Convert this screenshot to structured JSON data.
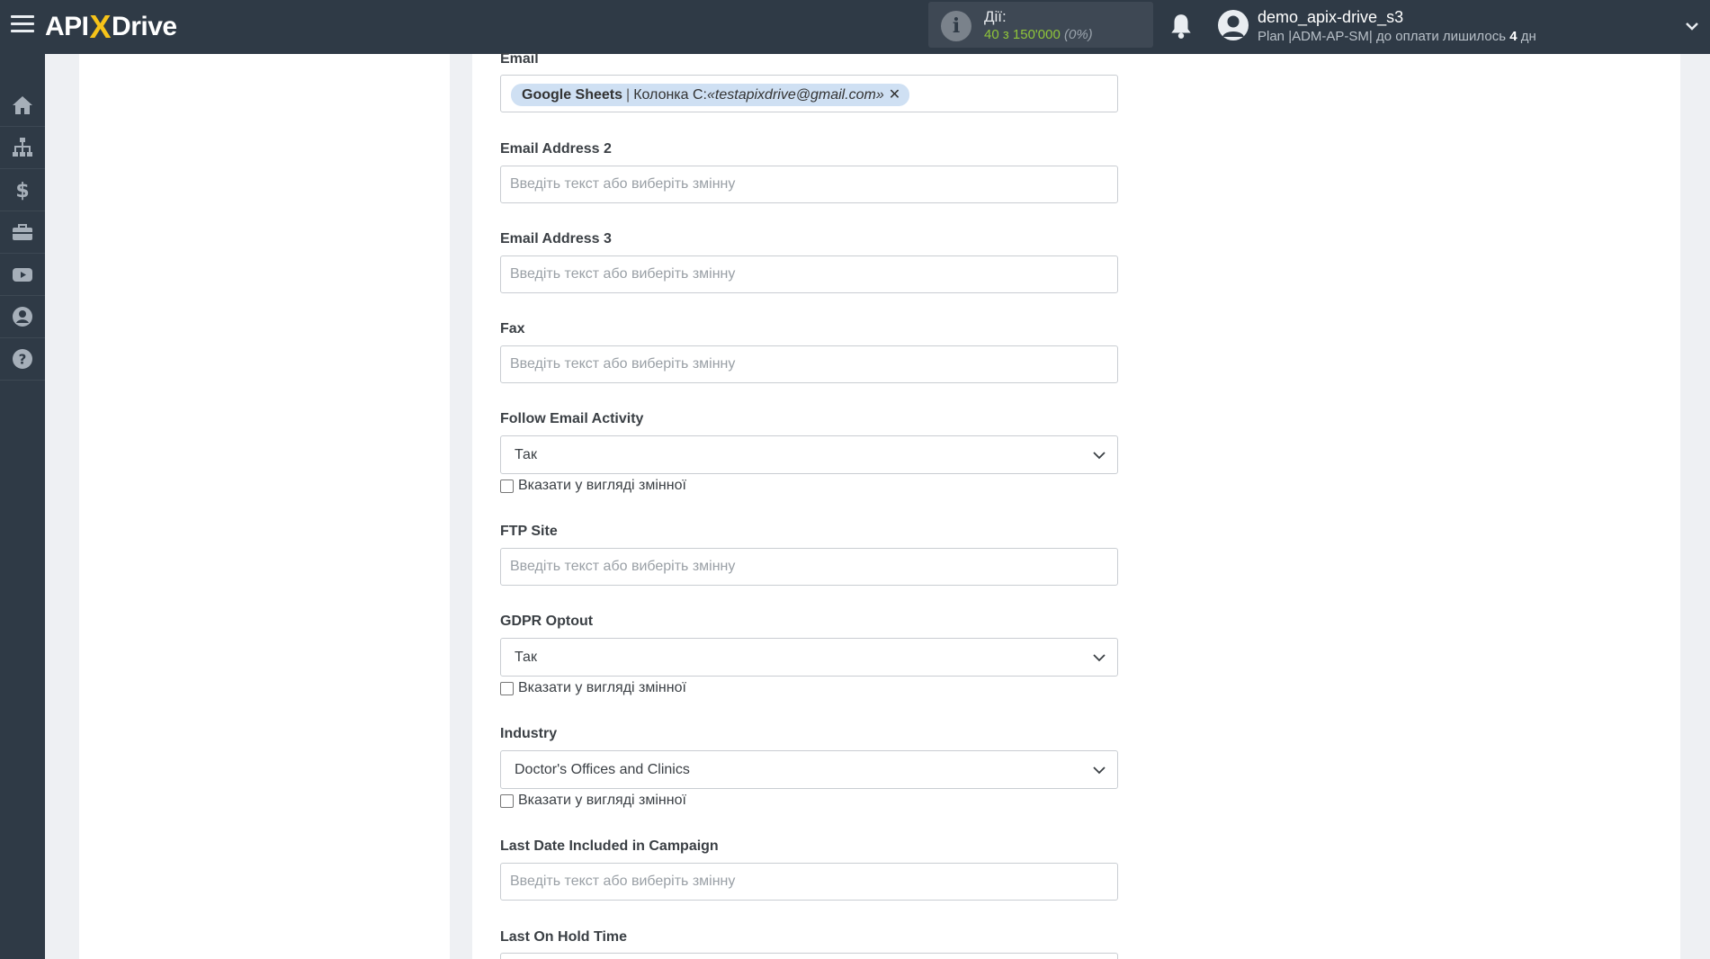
{
  "app": {
    "logo_left": "API",
    "logo_x": "X",
    "logo_right": "Drive"
  },
  "header": {
    "actions_label": "Дії:",
    "actions_count": "40 з 150'000",
    "actions_percent": "(0%)",
    "username": "demo_apix-drive_s3",
    "plan_text": "Plan |ADM-AP-SM| до оплати лишилось ",
    "plan_days": "4",
    "plan_unit": " дн"
  },
  "sidebar": {
    "items": [
      {
        "icon": "home-icon"
      },
      {
        "icon": "sitemap-icon"
      },
      {
        "icon": "dollar-icon"
      },
      {
        "icon": "briefcase-icon"
      },
      {
        "icon": "youtube-icon"
      },
      {
        "icon": "user-circle-icon"
      },
      {
        "icon": "question-circle-icon"
      }
    ]
  },
  "form": {
    "placeholder": "Введіть текст або виберіть змінну",
    "checkbox_label": "Вказати у вигляді змінної",
    "email": {
      "label": "Email",
      "tag_source": "Google Sheets",
      "tag_separator": "|",
      "tag_column": "Колонка С: ",
      "tag_value": "«testapixdrive@gmail.com»",
      "tag_remove": "✕"
    },
    "email2": {
      "label": "Email Address 2"
    },
    "email3": {
      "label": "Email Address 3"
    },
    "fax": {
      "label": "Fax"
    },
    "follow_email": {
      "label": "Follow Email Activity",
      "value": "Так"
    },
    "ftp": {
      "label": "FTP Site"
    },
    "gdpr": {
      "label": "GDPR Optout",
      "value": "Так"
    },
    "industry": {
      "label": "Industry",
      "value": "Doctor's Offices and Clinics"
    },
    "last_date": {
      "label": "Last Date Included in Campaign"
    },
    "last_hold": {
      "label": "Last On Hold Time"
    }
  },
  "colors": {
    "topbar": "#2f3a46",
    "accent_yellow": "#f6c319",
    "accent_green": "#8fc43a",
    "tag_bg": "#cfe0f3"
  }
}
